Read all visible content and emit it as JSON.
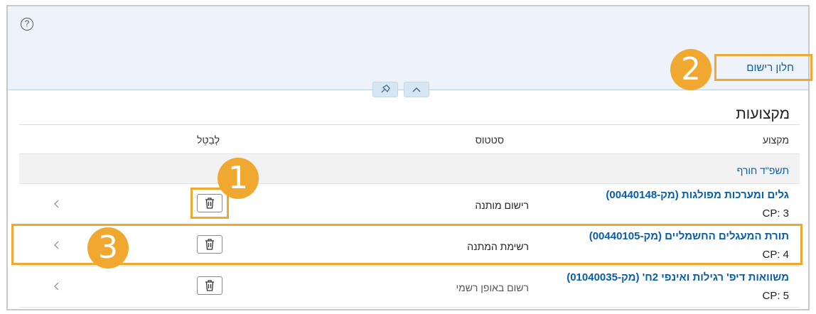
{
  "header": {
    "help_icon_label": "?",
    "registration_link": "חלון רישום"
  },
  "section": {
    "title": "מקצועות"
  },
  "table": {
    "columns": {
      "course": "מקצוע",
      "status": "סטטוס",
      "cancel": "לְבַטֵל"
    },
    "group": "תשפ\"ד חורף",
    "rows": [
      {
        "course": "גלים ומערכות מפולגות (מק-00440148)",
        "cp": "CP: 3",
        "status": "רישום מותנה",
        "status_muted": false
      },
      {
        "course": "תורת המעגלים החשמליים (מק-00440105)",
        "cp": "CP: 4",
        "status": "רשימת המתנה",
        "status_muted": false
      },
      {
        "course": "משוואות דיפ' רגילות ואינפי 2ח' (מק-01040035)",
        "cp": "CP: 5",
        "status": "רשום באופן רשמי",
        "status_muted": true
      }
    ]
  },
  "annotations": {
    "badges": [
      "1",
      "2",
      "3"
    ],
    "color": "#f0a830"
  },
  "colors": {
    "link": "#0a5da8",
    "header_bg": "#edf3f9"
  },
  "icons": [
    "help-icon",
    "pin-icon",
    "chevron-up-icon",
    "trash-icon",
    "chevron-left-icon"
  ]
}
